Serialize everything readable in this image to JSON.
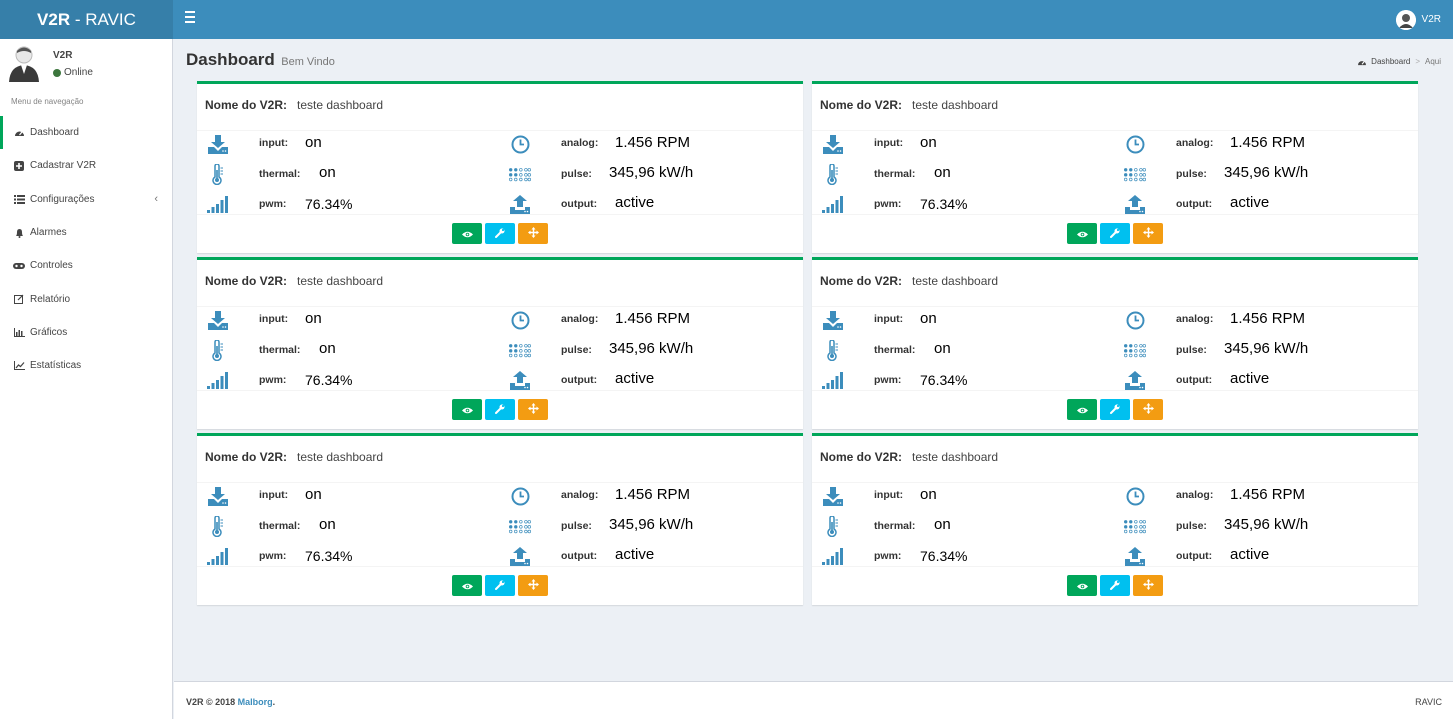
{
  "header": {
    "logo_bold": "V2R",
    "logo_rest": " - RAVIC",
    "user_name": "V2R"
  },
  "sidebar": {
    "user_name": "V2R",
    "status": "Online",
    "nav_header": "Menu de navegação",
    "items": [
      {
        "label": "Dashboard",
        "icon": "dashboard-icon",
        "active": true
      },
      {
        "label": "Cadastrar V2R",
        "icon": "plus-square-icon"
      },
      {
        "label": "Configurações",
        "icon": "list-icon",
        "has_submenu": true
      },
      {
        "label": "Alarmes",
        "icon": "bell-icon"
      },
      {
        "label": "Controles",
        "icon": "gamepad-icon"
      },
      {
        "label": "Relatório",
        "icon": "edit-icon"
      },
      {
        "label": "Gráficos",
        "icon": "bar-chart-icon"
      },
      {
        "label": "Estatísticas",
        "icon": "line-chart-icon"
      }
    ]
  },
  "content_header": {
    "title": "Dashboard",
    "subtitle": "Bem Vindo"
  },
  "breadcrumb": {
    "home": "Dashboard",
    "current": "Aqui"
  },
  "cards": [
    {
      "name_label": "Nome do V2R:",
      "name_value": "teste dashboard",
      "input_label": "input:",
      "input_value": "on",
      "thermal_label": "thermal:",
      "thermal_value": "on",
      "pwm_label": "pwm:",
      "pwm_value": "76.34%",
      "analog_label": "analog:",
      "analog_value": "1.456 RPM",
      "pulse_label": "pulse:",
      "pulse_value": "345,96 kW/h",
      "output_label": "output:",
      "output_value": "active"
    },
    {
      "name_label": "Nome do V2R:",
      "name_value": "teste dashboard",
      "input_label": "input:",
      "input_value": "on",
      "thermal_label": "thermal:",
      "thermal_value": "on",
      "pwm_label": "pwm:",
      "pwm_value": "76.34%",
      "analog_label": "analog:",
      "analog_value": "1.456 RPM",
      "pulse_label": "pulse:",
      "pulse_value": "345,96 kW/h",
      "output_label": "output:",
      "output_value": "active"
    },
    {
      "name_label": "Nome do V2R:",
      "name_value": "teste dashboard",
      "input_label": "input:",
      "input_value": "on",
      "thermal_label": "thermal:",
      "thermal_value": "on",
      "pwm_label": "pwm:",
      "pwm_value": "76.34%",
      "analog_label": "analog:",
      "analog_value": "1.456 RPM",
      "pulse_label": "pulse:",
      "pulse_value": "345,96 kW/h",
      "output_label": "output:",
      "output_value": "active"
    },
    {
      "name_label": "Nome do V2R:",
      "name_value": "teste dashboard",
      "input_label": "input:",
      "input_value": "on",
      "thermal_label": "thermal:",
      "thermal_value": "on",
      "pwm_label": "pwm:",
      "pwm_value": "76.34%",
      "analog_label": "analog:",
      "analog_value": "1.456 RPM",
      "pulse_label": "pulse:",
      "pulse_value": "345,96 kW/h",
      "output_label": "output:",
      "output_value": "active"
    },
    {
      "name_label": "Nome do V2R:",
      "name_value": "teste dashboard",
      "input_label": "input:",
      "input_value": "on",
      "thermal_label": "thermal:",
      "thermal_value": "on",
      "pwm_label": "pwm:",
      "pwm_value": "76.34%",
      "analog_label": "analog:",
      "analog_value": "1.456 RPM",
      "pulse_label": "pulse:",
      "pulse_value": "345,96 kW/h",
      "output_label": "output:",
      "output_value": "active"
    },
    {
      "name_label": "Nome do V2R:",
      "name_value": "teste dashboard",
      "input_label": "input:",
      "input_value": "on",
      "thermal_label": "thermal:",
      "thermal_value": "on",
      "pwm_label": "pwm:",
      "pwm_value": "76.34%",
      "analog_label": "analog:",
      "analog_value": "1.456 RPM",
      "pulse_label": "pulse:",
      "pulse_value": "345,96 kW/h",
      "output_label": "output:",
      "output_value": "active"
    }
  ],
  "card_buttons": [
    {
      "name": "view",
      "icon": "eye-icon",
      "color": "#00a65a"
    },
    {
      "name": "settings",
      "icon": "wrench-icon",
      "color": "#00c0ef"
    },
    {
      "name": "move",
      "icon": "arrows-icon",
      "color": "#f39c12"
    }
  ],
  "footer": {
    "left_prefix": "V2R © 2018 ",
    "brand": "Malborg",
    "left_suffix": ".",
    "right": "RAVIC"
  },
  "colors": {
    "header": "#3c8dbc",
    "logo_bg": "#367fa9",
    "card_top": "#00a65a",
    "icon_blue": "#3c8dbc"
  }
}
